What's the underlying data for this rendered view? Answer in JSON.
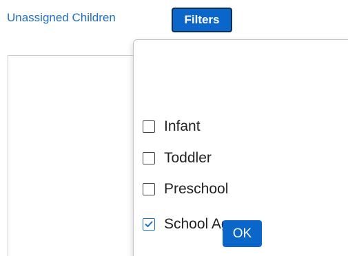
{
  "header": {
    "unassigned_link_text": "Unassigned Children",
    "filters_button_label": "Filters"
  },
  "filters_dropdown": {
    "options": [
      {
        "label": "Infant",
        "checked": false
      },
      {
        "label": "Toddler",
        "checked": false
      },
      {
        "label": "Preschool",
        "checked": false
      },
      {
        "label": "School Age",
        "checked": true
      }
    ],
    "ok_label": "OK"
  },
  "colors": {
    "link": "#1f6fc5",
    "primary_button": "#0a66c8",
    "primary_button_border": "#0b2e59",
    "checkbox_checked": "#1a6fd1"
  },
  "icons": {
    "checkmark": "check-icon"
  }
}
